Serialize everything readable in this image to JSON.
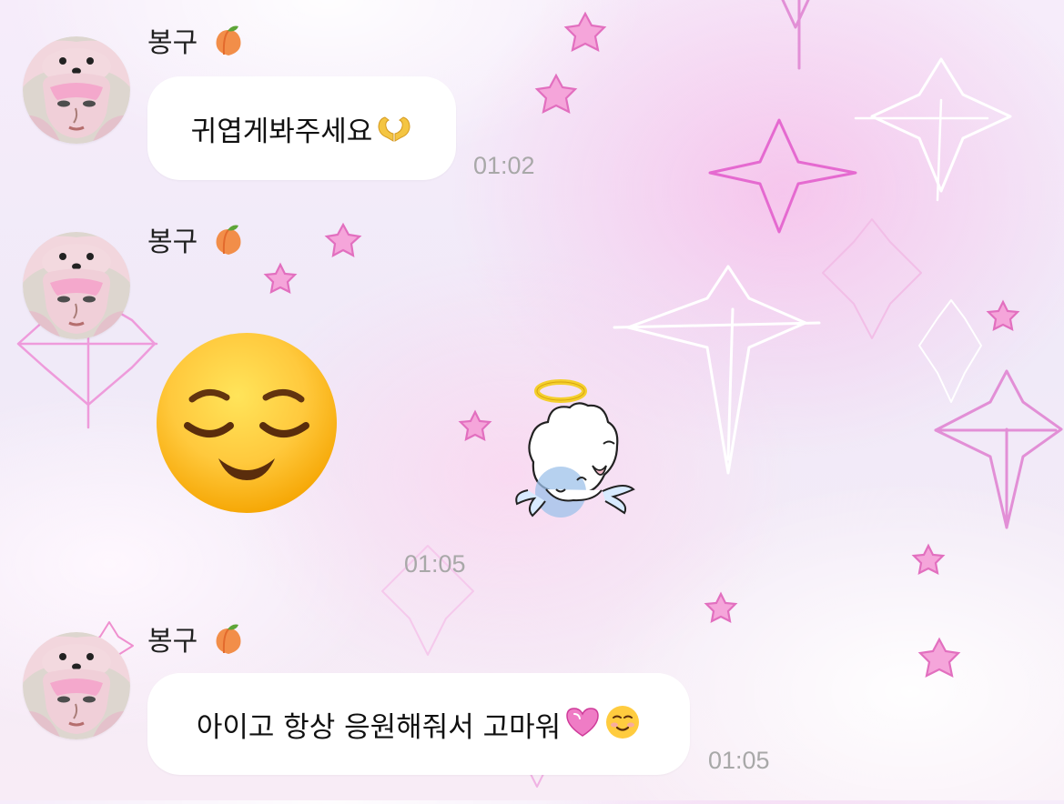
{
  "chat": {
    "messages": [
      {
        "sender": {
          "name": "봉구",
          "emoji_icon": "peach-icon"
        },
        "text": "귀엽게봐주세요",
        "trailing_icon": "heart-hands-icon",
        "time": "01:02"
      },
      {
        "sender": {
          "name": "봉구",
          "emoji_icon": "peach-icon"
        },
        "large_emoji_icon": "relieved-face-icon",
        "sticker_icon": "angel-cloud-sticker-icon",
        "time": "01:05"
      },
      {
        "sender": {
          "name": "봉구",
          "emoji_icon": "peach-icon"
        },
        "text": "아이고 항상 응원해줘서 고마워",
        "trailing_icons": [
          "pink-heart-icon",
          "smiling-face-icon"
        ],
        "time": "01:05"
      }
    ]
  },
  "colors": {
    "bubble": "#ffffff",
    "timestamp": "#a8a8a8",
    "accent_pink": "#ef8fcf",
    "background_pink": "#f5d9ef"
  }
}
